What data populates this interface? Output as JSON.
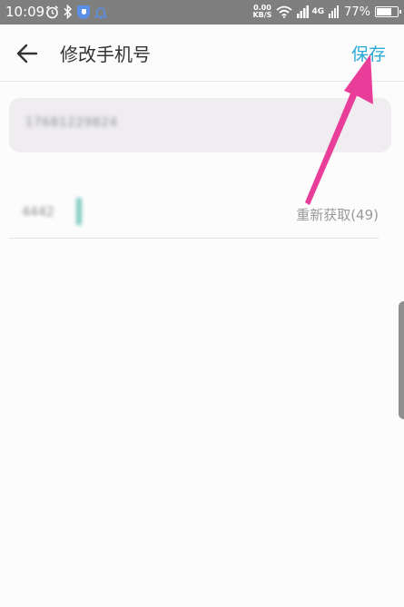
{
  "status_bar": {
    "time": "10:09",
    "net_speed_value": "0.00",
    "net_speed_unit": "KB/S",
    "signal_label": "4G",
    "battery_percent": "77%",
    "battery_level": 0.77
  },
  "header": {
    "title": "修改手机号",
    "save_label": "保存"
  },
  "form": {
    "phone_value": "17681229824",
    "code_value": "4442",
    "resend_label": "重新获取(49)"
  },
  "colors": {
    "accent": "#29a9d8",
    "annotation_arrow": "#e83e9a"
  }
}
